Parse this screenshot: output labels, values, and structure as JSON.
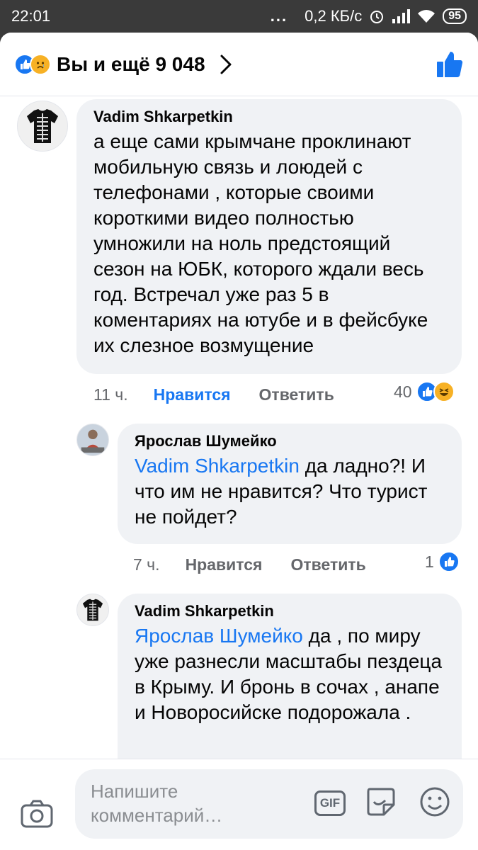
{
  "status_bar": {
    "time": "22:01",
    "dots": "...",
    "speed": "0,2 КБ/с",
    "battery": "95"
  },
  "header": {
    "title": "Вы и ещё 9 048",
    "reaction_icons": [
      "like-icon",
      "sad-icon"
    ]
  },
  "comments": [
    {
      "author": "Vadim Shkarpetkin",
      "text": "а еще сами крымчане проклинают мобильную связь и лоюдей с телефонами , которые своими короткими видео полностью умножили на ноль предстоящий сезон на ЮБК, которого ждали весь год. Встречал уже раз 5 в коментариях на ютубе и в фейсбуке их слезное возмущение",
      "time": "11 ч.",
      "like_label": "Нравится",
      "reply_label": "Ответить",
      "reaction_count": "40",
      "reactions": [
        "like-icon",
        "haha-icon"
      ]
    },
    {
      "author": "Ярослав Шумейко",
      "mention": "Vadim Shkarpetkin",
      "text": " да ладно?! И что им не нравится? Что турист не пойдет?",
      "time": "7 ч.",
      "like_label": "Нравится",
      "reply_label": "Ответить",
      "reaction_count": "1",
      "reactions": [
        "like-icon"
      ]
    },
    {
      "author": "Vadim Shkarpetkin",
      "mention": "Ярослав Шумейко",
      "text": " да , по миру уже разнесли масштабы пездеца в Крыму. И бронь в сочах , анапе и  Новоросийске подорожала ."
    }
  ],
  "composer": {
    "placeholder": "Напишите комментарий…",
    "gif_label": "GIF"
  },
  "colors": {
    "accent": "#1877f2",
    "bubble": "#f0f2f5",
    "meta": "#65676b",
    "haha": "#f7b125"
  }
}
